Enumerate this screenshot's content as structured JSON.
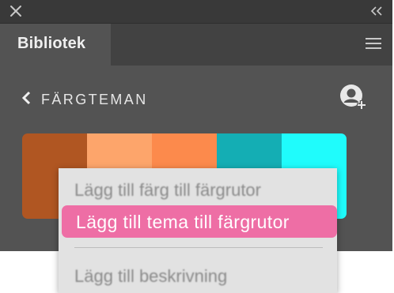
{
  "panel": {
    "close_icon": "close-icon",
    "collapse_icon": "double-chevron-left-icon",
    "tab_label": "Bibliotek",
    "menu_icon": "hamburger-menu-icon"
  },
  "nav": {
    "back_icon": "chevron-left-icon",
    "title": "FÄRGTEMAN",
    "user_icon": "add-user-icon"
  },
  "theme_swatches": [
    {
      "name": "swatch-1",
      "color": "#b05622"
    },
    {
      "name": "swatch-2",
      "color": "#fda56b"
    },
    {
      "name": "swatch-3",
      "color": "#fc8a4c"
    },
    {
      "name": "swatch-4",
      "color": "#14aeb4"
    },
    {
      "name": "swatch-5",
      "color": "#1ffcfc"
    }
  ],
  "context_menu": {
    "items": [
      {
        "label": "Lägg till färg till färgrutor",
        "highlighted": false
      },
      {
        "label": "Lägg till tema till färgrutor",
        "highlighted": true
      },
      {
        "label": "Lägg till beskrivning",
        "highlighted": false
      }
    ]
  },
  "colors": {
    "panel_bg": "#535353",
    "titlebar_bg": "#393939",
    "highlight": "#ee6ea5",
    "menu_bg": "#e2e2e2"
  }
}
